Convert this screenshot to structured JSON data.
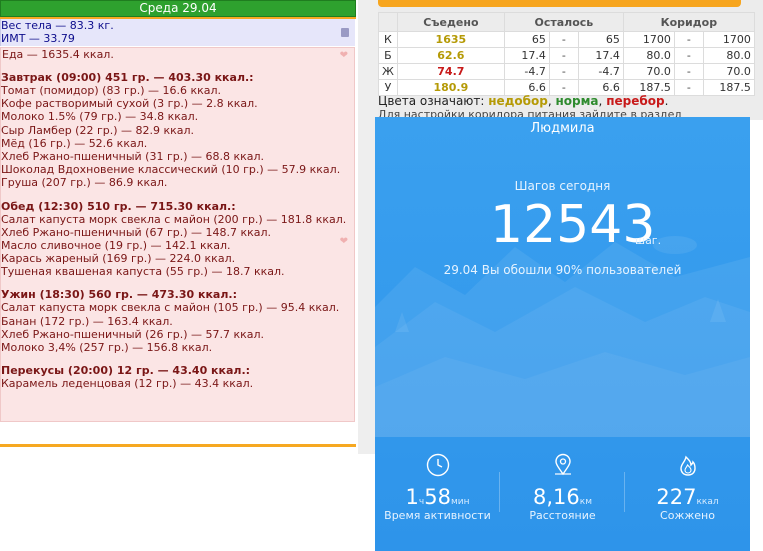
{
  "diary": {
    "day_header": "Среда 29.04",
    "weight": "Вес тела — 83.3 кг.",
    "bmi": "ИМТ — 33.79",
    "food_total": "Еда — 1635.4 ккал.",
    "meals": [
      {
        "title": "Завтрак (09:00) 451 гр. — 403.30 ккал.:",
        "items": [
          "Томат (помидор) (83 гр.) — 16.6 ккал.",
          "Кофе растворимый сухой (3 гр.) — 2.8 ккал.",
          "Молоко 1.5% (79 гр.) — 34.8 ккал.",
          "Сыр Ламбер (22 гр.) — 82.9 ккал.",
          "Мёд (16 гр.) — 52.6 ккал.",
          "Хлеб Ржано-пшеничный (31 гр.) — 68.8 ккал.",
          "Шоколад Вдохновение классический (10 гр.) — 57.9 ккал.",
          "Груша (207 гр.) — 86.9 ккал."
        ]
      },
      {
        "title": "Обед (12:30) 510 гр. — 715.30 ккал.:",
        "items": [
          "Салат капуста морк свекла с майон (200 гр.) — 181.8 ккал.",
          "Хлеб Ржано-пшеничный (67 гр.) — 148.7 ккал.",
          "Масло сливочное (19 гр.) — 142.1 ккал.",
          "Карась жареный (169 гр.) — 224.0 ккал.",
          "Тушеная квашеная капуста (55 гр.) — 18.7 ккал."
        ]
      },
      {
        "title": "Ужин (18:30) 560 гр. — 473.30 ккал.:",
        "items": [
          "Салат капуста морк свекла с майон (105 гр.) — 95.4 ккал.",
          "Банан (172 гр.) — 163.4 ккал.",
          "Хлеб Ржано-пшеничный (26 гр.) — 57.7 ккал.",
          "Молоко 3,4% (257 гр.) — 156.8 ккал."
        ]
      },
      {
        "title": "Перекусы (20:00) 12 гр. — 43.40 ккал.:",
        "items": [
          "Карамель леденцовая (12 гр.) — 43.4 ккал."
        ]
      }
    ]
  },
  "nutrients": {
    "headers": {
      "eaten": "Съедено",
      "left": "Осталось",
      "corridor": "Коридор"
    },
    "rows": [
      {
        "code": "К",
        "eaten": "1635",
        "eaten_color": "#b59a06",
        "left_a": "65",
        "left_b": "65",
        "cor_a": "1700",
        "cor_b": "1700"
      },
      {
        "code": "Б",
        "eaten": "62.6",
        "eaten_color": "#b59a06",
        "left_a": "17.4",
        "left_b": "17.4",
        "cor_a": "80.0",
        "cor_b": "80.0"
      },
      {
        "code": "Ж",
        "eaten": "74.7",
        "eaten_color": "#c81a1a",
        "left_a": "-4.7",
        "left_b": "-4.7",
        "cor_a": "70.0",
        "cor_b": "70.0"
      },
      {
        "code": "У",
        "eaten": "180.9",
        "eaten_color": "#b59a06",
        "left_a": "6.6",
        "left_b": "6.6",
        "cor_a": "187.5",
        "cor_b": "187.5"
      }
    ],
    "dash": "-",
    "legend": {
      "prefix": "Цвета означают:",
      "under": "недобор",
      "sep1": ",",
      "norm": "норма",
      "sep2": ",",
      "over": "перебор",
      "end": "."
    },
    "hint": "Для настройки коридора питания зайдите в раздел"
  },
  "fitness": {
    "name": "Людмила",
    "steps_label": "Шагов сегодня",
    "steps": "12543",
    "steps_unit": "шаг.",
    "compare": "29.04 Вы обошли 90% пользователей",
    "stats": [
      {
        "icon": "clock-icon",
        "value_a": "1",
        "unit_a": "ч",
        "value_b": "58",
        "unit_b": "мин",
        "label": "Время активности"
      },
      {
        "icon": "location-pin-icon",
        "value_a": "8,16",
        "unit_a": "км",
        "value_b": "",
        "unit_b": "",
        "label": "Расстояние"
      },
      {
        "icon": "flame-icon",
        "value_a": "227",
        "unit_a": "ккал",
        "value_b": "",
        "unit_b": "",
        "label": "Сожжено"
      }
    ]
  },
  "colors": {
    "header_green": "#2ea12e",
    "accent_orange": "#f6a821",
    "meals_bg": "#fbe5e5",
    "fitness_blue": "#3aa0ef"
  }
}
